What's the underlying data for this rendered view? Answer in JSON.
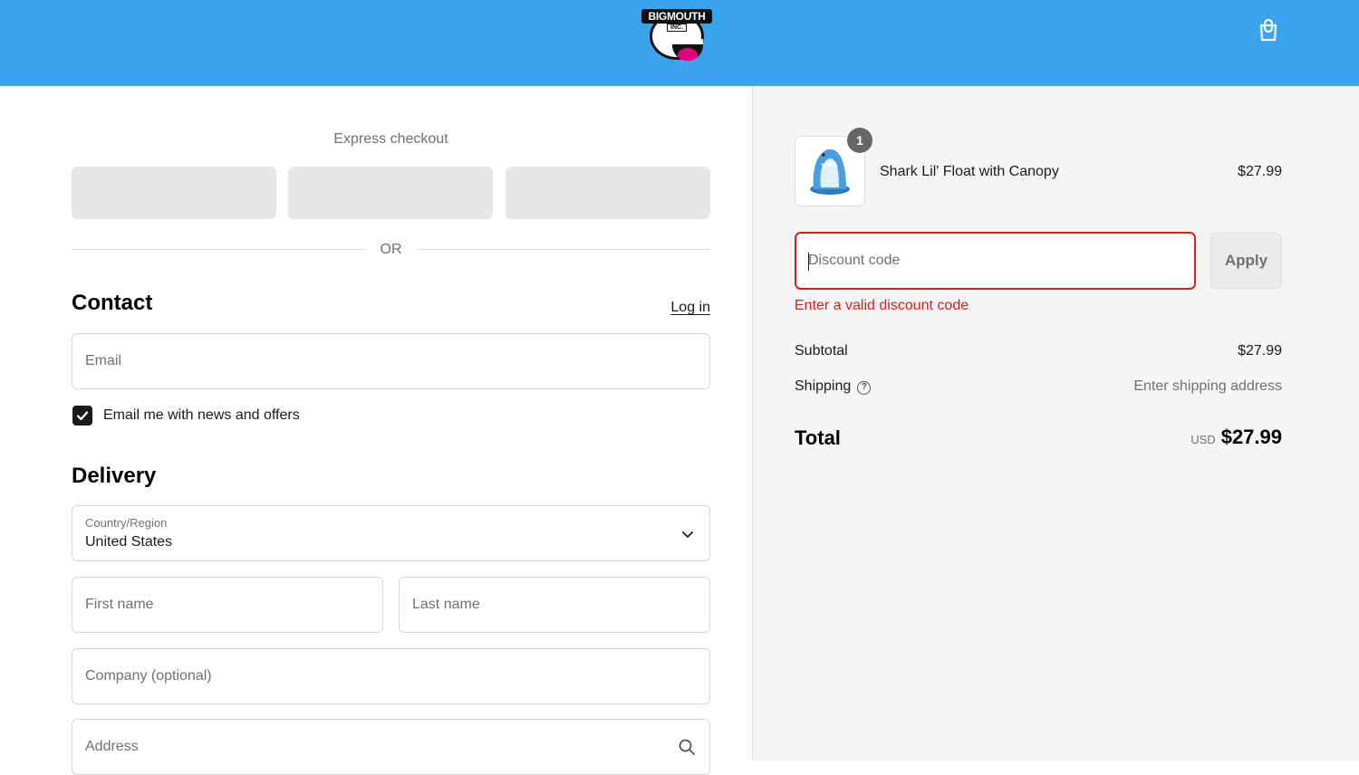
{
  "header": {
    "logo_text": "BIGMOUTH",
    "logo_sub": "INC.",
    "cart_icon": "shopping-bag-icon",
    "bg_color": "#3aa3ee"
  },
  "express": {
    "title": "Express checkout",
    "or_text": "OR"
  },
  "contact": {
    "title": "Contact",
    "login_link": "Log in",
    "email_placeholder": "Email",
    "newsletter_label": "Email me with news and offers",
    "newsletter_checked": true
  },
  "delivery": {
    "title": "Delivery",
    "country_label": "Country/Region",
    "country_value": "United States",
    "first_name_placeholder": "First name",
    "last_name_placeholder": "Last name",
    "company_placeholder": "Company (optional)",
    "address_placeholder": "Address"
  },
  "summary": {
    "item": {
      "name": "Shark Lil' Float with Canopy",
      "price": "$27.99",
      "quantity": "1"
    },
    "discount_placeholder": "Discount code",
    "apply_label": "Apply",
    "error_text": "Enter a valid discount code",
    "error_color": "#dd1d1d",
    "subtotal_label": "Subtotal",
    "subtotal_value": "$27.99",
    "shipping_label": "Shipping",
    "shipping_value": "Enter shipping address",
    "total_label": "Total",
    "currency": "USD",
    "total_value": "$27.99"
  }
}
